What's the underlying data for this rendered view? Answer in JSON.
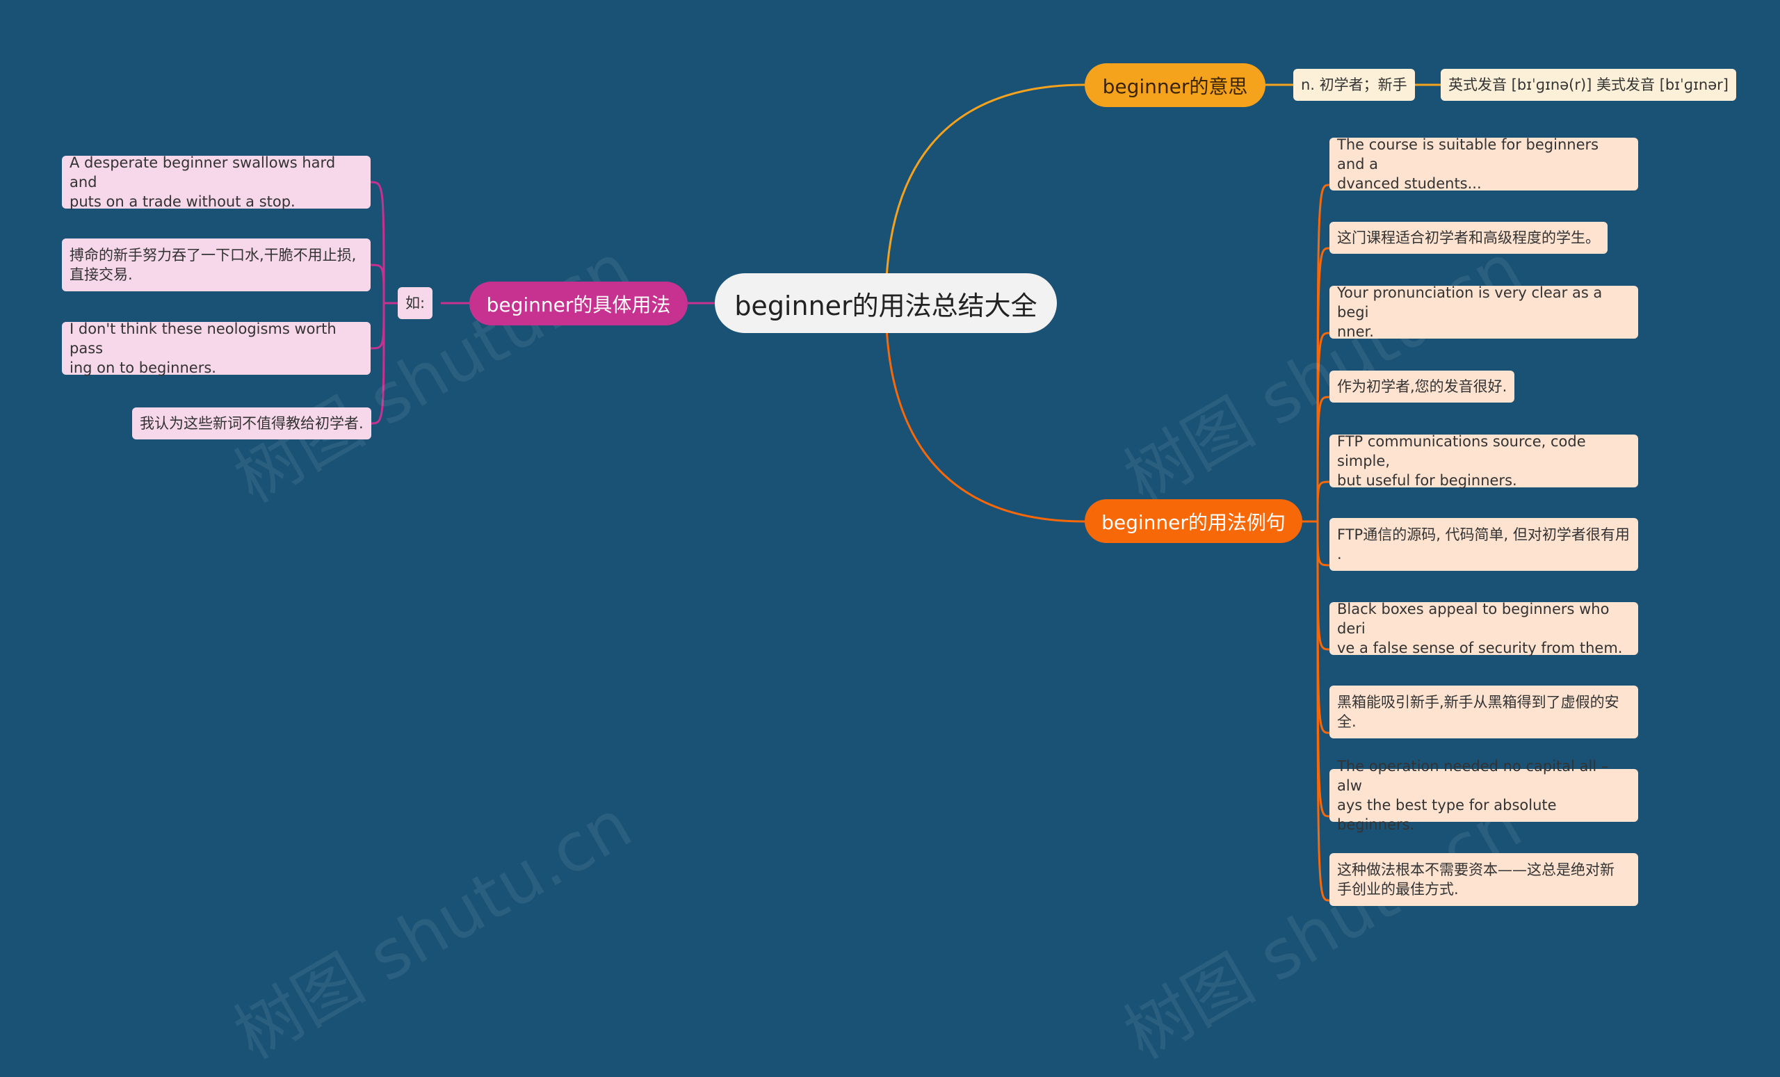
{
  "root": {
    "label": "beginner的用法总结大全"
  },
  "meaning": {
    "label": "beginner的意思",
    "items": [
      "n. 初学者；新手",
      "英式发音 [bɪˈɡɪnə(r)] 美式发音 [bɪˈɡɪnər]"
    ]
  },
  "examples": {
    "label": "beginner的用法例句",
    "items": [
      "The course is suitable for beginners and a\ndvanced students...",
      "这门课程适合初学者和高级程度的学生。",
      "Your pronunciation is very clear as a begi\nnner.",
      "作为初学者,您的发音很好.",
      "FTP communications source, code simple,\n but useful for beginners.",
      "FTP通信的源码, 代码简单, 但对初学者很有用\n.",
      "Black boxes appeal to beginners who deri\nve a false sense of security from them.",
      "黑箱能吸引新手,新手从黑箱得到了虚假的安\n全.",
      "The operation needed no capital all – alw\nays the best type for absolute beginners.",
      "这种做法根本不需要资本——这总是绝对新\n手创业的最佳方式."
    ]
  },
  "usage": {
    "label": "beginner的具体用法",
    "connector_label": "如:",
    "items": [
      "A desperate beginner swallows hard and\nputs on a trade without a stop.",
      "搏命的新手努力吞了一下口水,干脆不用止损,\n直接交易.",
      "I don't think these neologisms worth pass\ning on to beginners.",
      "我认为这些新词不值得教给初学者."
    ]
  },
  "watermarks": [
    "树图 shutu.cn",
    "树图 shutu.cn",
    "树图 shutu.cn",
    "树图 shutu.cn"
  ],
  "colors": {
    "background": "#1a5276",
    "meaning_branch": "#f5a21d",
    "example_branch": "#f76809",
    "usage_branch": "#c7318f",
    "root": "#f2f2f2"
  }
}
